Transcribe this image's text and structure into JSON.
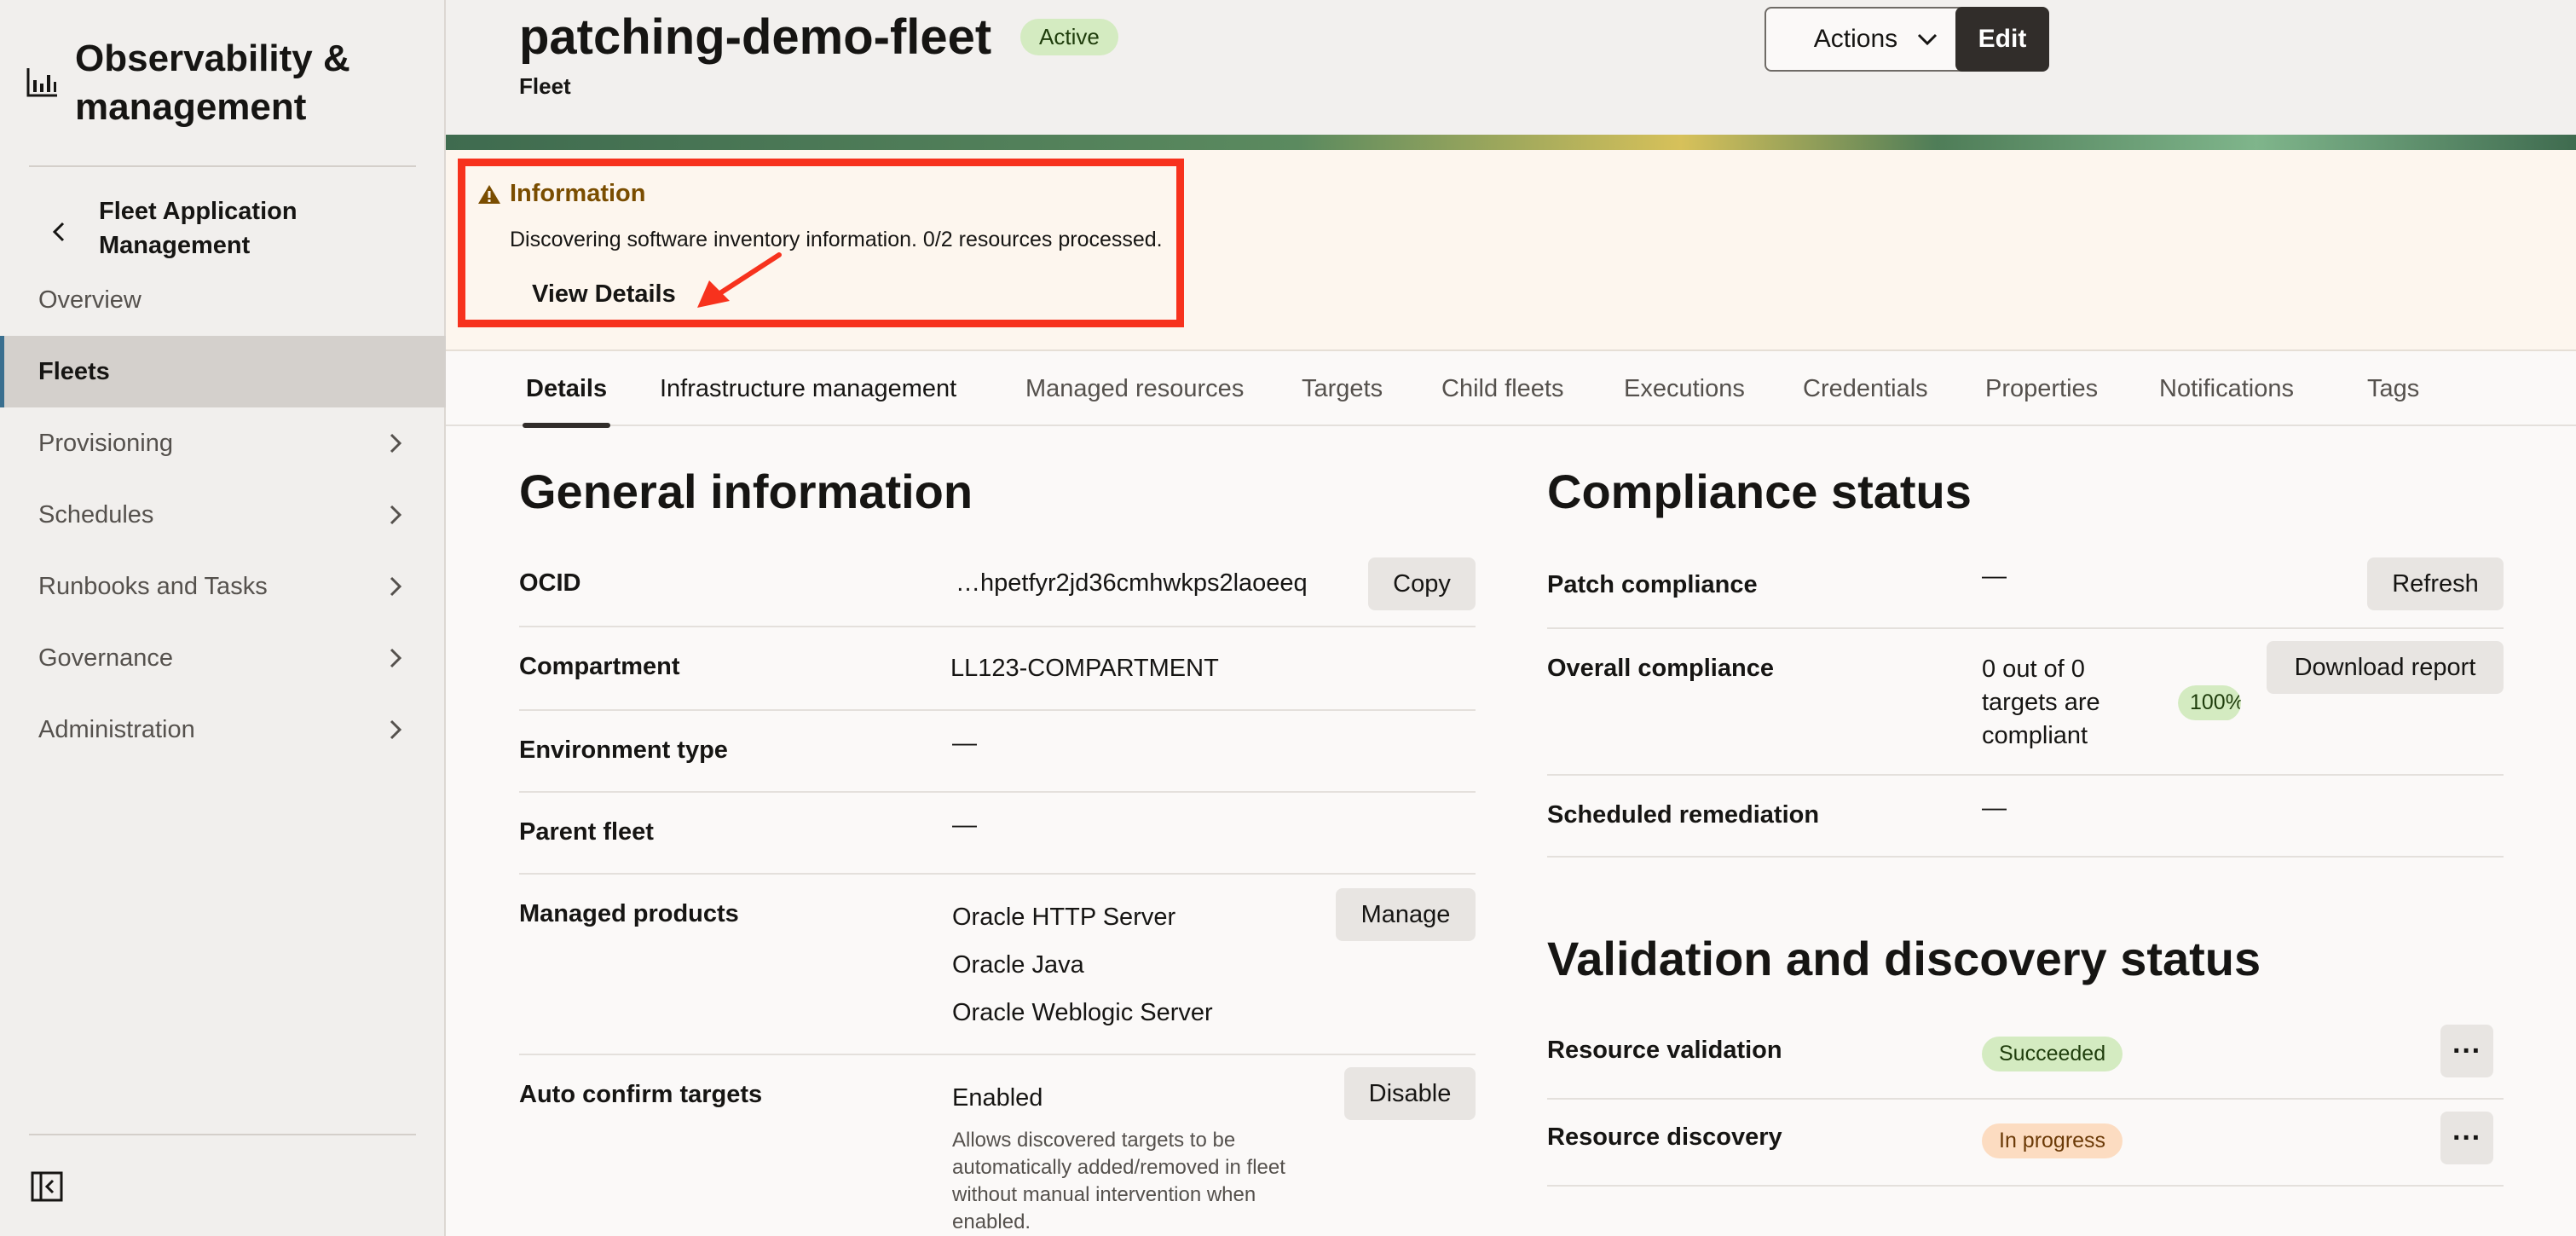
{
  "sidebar": {
    "app_title": "Observability & management",
    "back_label": "Fleet Application Management",
    "items": [
      {
        "label": "Overview",
        "has_children": false,
        "active": false
      },
      {
        "label": "Fleets",
        "has_children": false,
        "active": true
      },
      {
        "label": "Provisioning",
        "has_children": true,
        "active": false
      },
      {
        "label": "Schedules",
        "has_children": true,
        "active": false
      },
      {
        "label": "Runbooks and Tasks",
        "has_children": true,
        "active": false
      },
      {
        "label": "Governance",
        "has_children": true,
        "active": false
      },
      {
        "label": "Administration",
        "has_children": true,
        "active": false
      }
    ]
  },
  "header": {
    "title": "patching-demo-fleet",
    "status": "Active",
    "subtitle": "Fleet",
    "actions_label": "Actions",
    "edit_label": "Edit"
  },
  "info": {
    "title": "Information",
    "message": "Discovering software inventory information. 0/2 resources processed.",
    "link": "View Details"
  },
  "tabs": [
    "Details",
    "Infrastructure management",
    "Managed resources",
    "Targets",
    "Child fleets",
    "Executions",
    "Credentials",
    "Properties",
    "Notifications",
    "Tags"
  ],
  "general": {
    "title": "General information",
    "ocid_label": "OCID",
    "ocid_value": "…hpetfyr2jd36cmhwkps2laoeeq",
    "copy_label": "Copy",
    "compartment_label": "Compartment",
    "compartment_value": "LL123-COMPARTMENT",
    "env_label": "Environment type",
    "env_value": "—",
    "parent_label": "Parent fleet",
    "parent_value": "—",
    "products_label": "Managed products",
    "products": [
      "Oracle HTTP Server",
      "Oracle Java",
      "Oracle Weblogic Server"
    ],
    "manage_label": "Manage",
    "auto_label": "Auto confirm targets",
    "auto_value": "Enabled",
    "auto_help": "Allows discovered targets to be automatically added/removed in fleet without manual intervention when enabled.",
    "disable_label": "Disable"
  },
  "compliance": {
    "title": "Compliance status",
    "patch_label": "Patch compliance",
    "patch_value": "—",
    "refresh_label": "Refresh",
    "overall_label": "Overall compliance",
    "overall_value": "0 out of 0 targets are compliant",
    "overall_pct": "100%",
    "download_label": "Download report",
    "sched_label": "Scheduled remediation",
    "sched_value": "—"
  },
  "validation": {
    "title": "Validation and discovery status",
    "resource_validation_label": "Resource validation",
    "resource_validation_status": "Succeeded",
    "resource_discovery_label": "Resource discovery",
    "resource_discovery_status": "In progress",
    "more_glyph": "···"
  },
  "colors": {
    "annotation_red": "#f7321d",
    "success_green": "#d4ebc1",
    "progress_orange": "#fcdcc1",
    "primary_dark": "#312d2a"
  }
}
